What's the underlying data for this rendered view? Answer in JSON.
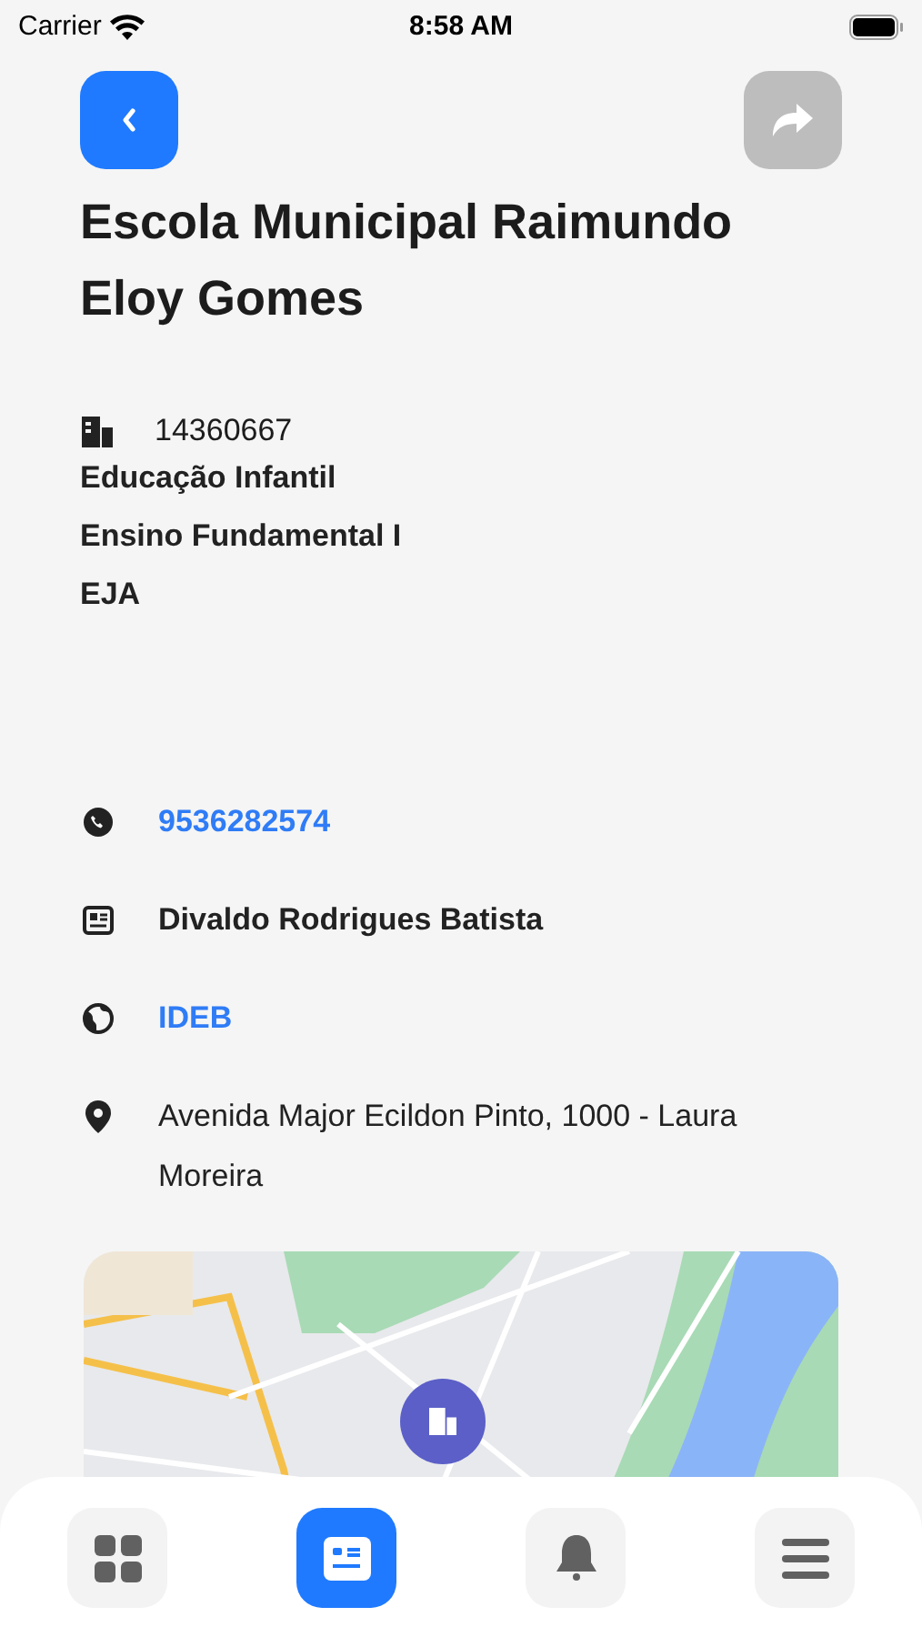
{
  "status_bar": {
    "carrier": "Carrier",
    "time": "8:58 AM"
  },
  "header": {
    "back": {
      "disabled": false
    },
    "share": {
      "disabled": true
    }
  },
  "title": "Escola Municipal Raimundo Eloy Gomes",
  "school_code": "14360667",
  "levels": [
    "Educação Infantil",
    "Ensino Fundamental I",
    "EJA"
  ],
  "contacts": [
    {
      "kind": "link",
      "text": "9536282574"
    },
    {
      "kind": "text",
      "text": "Divaldo Rodrigues Batista"
    },
    {
      "kind": "link",
      "text": "IDEB"
    },
    {
      "kind": "plain",
      "text": "Avenida Major Ecildon Pinto, 1000 - Laura Moreira"
    }
  ],
  "map": {
    "kind": "picture"
  },
  "tab_bar": [
    {
      "selected": false
    },
    {
      "selected": true
    },
    {
      "selected": false
    },
    {
      "selected": false
    }
  ]
}
